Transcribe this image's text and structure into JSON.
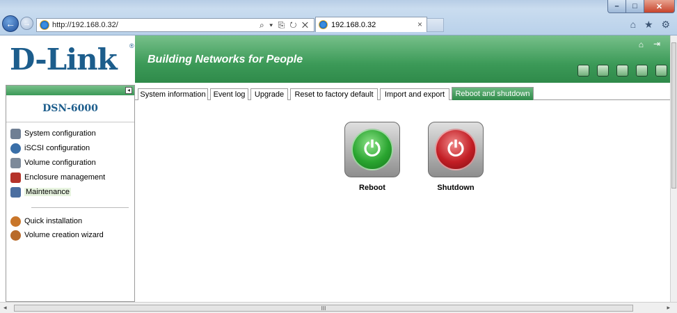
{
  "browser": {
    "url": "http://192.168.0.32/",
    "address_tools": "⌕ ▾ ⎘ ↻ ✕",
    "tab_title": "192.168.0.32",
    "tab_close": "×",
    "window_buttons": {
      "minimize": "–",
      "maximize": "□",
      "close": "✕"
    },
    "nav_back": "←",
    "nav_forward": "→",
    "right_icons": "⌂ ★ ⚙"
  },
  "header": {
    "logo": "D-Link",
    "logo_mark": "®",
    "tagline": "Building Networks for People",
    "home_icon": "⌂",
    "logout_icon": "⇥"
  },
  "sidebar": {
    "model": "DSN-6000",
    "collapse": "◂",
    "items": [
      {
        "label": "System configuration",
        "icon": "monitor-icon",
        "color": "#6f7f94"
      },
      {
        "label": "iSCSI configuration",
        "icon": "globe-icon",
        "color": "#3a6fa8"
      },
      {
        "label": "Volume configuration",
        "icon": "disk-icon",
        "color": "#7d8a9a"
      },
      {
        "label": "Enclosure management",
        "icon": "enclosure-icon",
        "color": "#b5332a"
      },
      {
        "label": "Maintenance",
        "icon": "maintenance-icon",
        "color": "#4b6ea0"
      }
    ],
    "wizards": [
      {
        "label": "Quick installation",
        "icon": "quick-install-icon",
        "color": "#c9762a"
      },
      {
        "label": "Volume creation wizard",
        "icon": "volume-wizard-icon",
        "color": "#b86a2a"
      }
    ]
  },
  "tabs": [
    {
      "label": "System information",
      "active": false
    },
    {
      "label": "Event log",
      "active": false
    },
    {
      "label": "Upgrade",
      "active": false
    },
    {
      "label": "Reset to factory default",
      "active": false
    },
    {
      "label": "Import and export",
      "active": false
    },
    {
      "label": "Reboot and shutdown",
      "active": true
    }
  ],
  "actions": {
    "reboot_label": "Reboot",
    "shutdown_label": "Shutdown",
    "power_symbol": "⏻"
  },
  "scrollbar": {
    "grip": "III",
    "left_arrow": "◂",
    "right_arrow": "▸"
  }
}
